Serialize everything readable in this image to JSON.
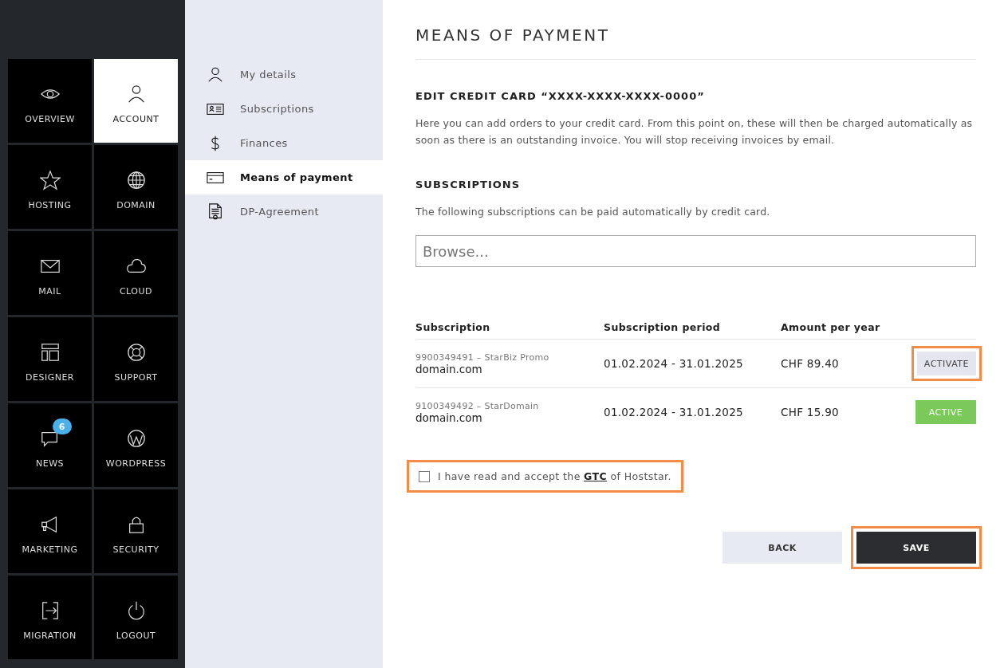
{
  "main_nav": [
    {
      "label": "OVERVIEW",
      "selected": false
    },
    {
      "label": "ACCOUNT",
      "selected": true
    },
    {
      "label": "HOSTING",
      "selected": false
    },
    {
      "label": "DOMAIN",
      "selected": false
    },
    {
      "label": "MAIL",
      "selected": false
    },
    {
      "label": "CLOUD",
      "selected": false
    },
    {
      "label": "DESIGNER",
      "selected": false
    },
    {
      "label": "SUPPORT",
      "selected": false
    },
    {
      "label": "NEWS",
      "selected": false,
      "badge": "6"
    },
    {
      "label": "WORDPRESS",
      "selected": false
    },
    {
      "label": "MARKETING",
      "selected": false
    },
    {
      "label": "SECURITY",
      "selected": false
    },
    {
      "label": "MIGRATION",
      "selected": false
    },
    {
      "label": "LOGOUT",
      "selected": false
    }
  ],
  "sub_nav": [
    {
      "label": "My details",
      "selected": false
    },
    {
      "label": "Subscriptions",
      "selected": false
    },
    {
      "label": "Finances",
      "selected": false
    },
    {
      "label": "Means of payment",
      "selected": true
    },
    {
      "label": "DP-Agreement",
      "selected": false
    }
  ],
  "page_title": "MEANS OF PAYMENT",
  "edit_heading": "EDIT CREDIT CARD “XXXX-XXXX-XXXX-0000”",
  "edit_text": "Here you can add orders to your credit card. From this point on, these will then be charged automatically as soon as there is an outstanding invoice. You will stop receiving invoices by email.",
  "subscriptions_heading": "SUBSCRIPTIONS",
  "subscriptions_text": "The following subscriptions can be paid automatically by credit card.",
  "search": {
    "placeholder": "Browse..."
  },
  "table": {
    "columns": [
      "Subscription",
      "Subscription period",
      "Amount per year"
    ],
    "rows": [
      {
        "id": "9900349491 – StarBiz Promo",
        "domain": "domain.com",
        "period": "01.02.2024 - 31.01.2025",
        "amount": "CHF 89.40",
        "action": "ACTIVATE",
        "active": false,
        "highlighted": true
      },
      {
        "id": "9100349492 – StarDomain",
        "domain": "domain.com",
        "period": "01.02.2024 - 31.01.2025",
        "amount": "CHF 15.90",
        "action": "ACTIVE",
        "active": true,
        "highlighted": false
      }
    ]
  },
  "terms": {
    "before": "I have read and accept the",
    "link": "GTC",
    "after": "of Hoststar.",
    "checked": false,
    "highlighted": true
  },
  "buttons": [
    {
      "label": "BACK",
      "kind": "secondary",
      "highlighted": false
    },
    {
      "label": "SAVE",
      "kind": "primary",
      "highlighted": true
    }
  ]
}
